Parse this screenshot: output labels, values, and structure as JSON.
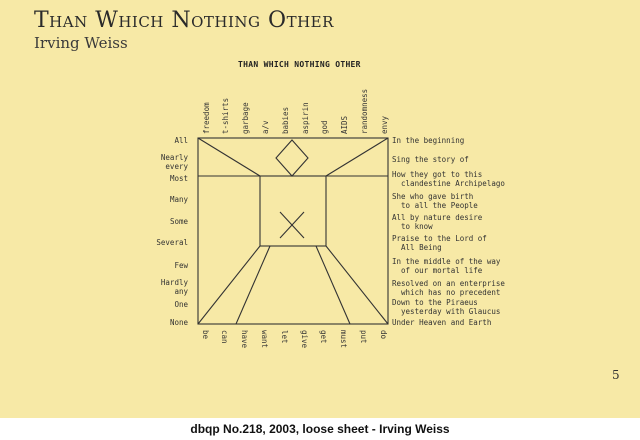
{
  "header": {
    "title": "Than Which Nothing Other",
    "author": "Irving Weiss"
  },
  "poem": {
    "title": "THAN WHICH NOTHING OTHER",
    "top_words": [
      "freedom",
      "t-shirts",
      "garbage",
      "a/v",
      "babies",
      "aspirin",
      "god",
      "AIDS",
      "randomness",
      "envy"
    ],
    "bottom_words": [
      "be",
      "can",
      "have",
      "want",
      "let",
      "give",
      "get",
      "must",
      "put",
      "do"
    ],
    "left_words": [
      "All",
      "Nearly\nevery",
      "Most",
      "Many",
      "Some",
      "Several",
      "Few",
      "Hardly\nany",
      "One",
      "None"
    ],
    "right_lines": [
      "In the beginning",
      "Sing the story of",
      "How they got to this\n  clandestine Archipelago",
      "She who gave birth\n  to all the People",
      "All by nature desire\n  to know",
      "Praise to the Lord of\n  All Being",
      "In the middle of the way\n  of our mortal life",
      "Resolved on an enterprise\n  which has no precedent",
      "Down to the Piraeus\n  yesterday with Glaucus",
      "Under Heaven and Earth"
    ]
  },
  "page_number": "5",
  "caption": "dbqp No.218, 2003, loose sheet - Irving Weiss"
}
